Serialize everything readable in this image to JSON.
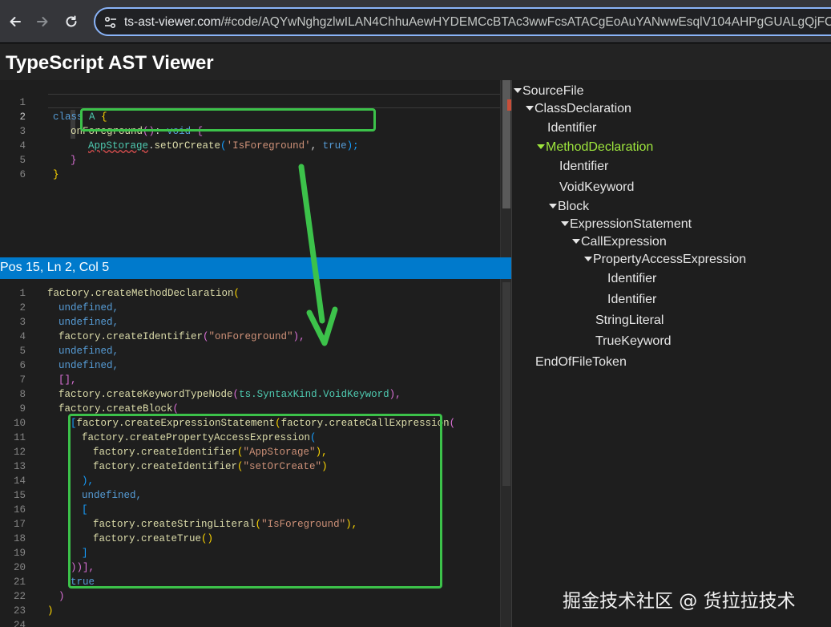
{
  "browser": {
    "url_host": "ts-ast-viewer.com",
    "url_rest": "/#code/AQYwNghgzlwILAN4ChhuAewHYDEMCcBTAc3wwFcsATACgEoAuYANwwEsqlV104AHPgGUALgQjFCAOiiFhAc"
  },
  "header": {
    "title": "TypeScript AST Viewer"
  },
  "status": {
    "text": "Pos 15, Ln 2, Col 5"
  },
  "source_code": {
    "line_numbers": [
      "1",
      "2",
      "3",
      "4",
      "5",
      "6"
    ],
    "l1": {
      "kw": "class",
      "name": "A",
      "brace": "{"
    },
    "l2": {
      "name": "onForeground",
      "paren": "()",
      "colon": ":",
      "type": "void",
      "brace": "{"
    },
    "l3": {
      "obj": "AppStorage",
      "dot": ".",
      "fn": "setOrCreate",
      "open": "(",
      "str": "'IsForeground'",
      "comma": ",",
      "val": "true",
      "close": ");"
    },
    "l4": {
      "brace": "}"
    },
    "l5": {
      "brace": "}"
    }
  },
  "factory_code": {
    "line_numbers": [
      "1",
      "2",
      "3",
      "4",
      "5",
      "6",
      "7",
      "8",
      "9",
      "10",
      "11",
      "12",
      "13",
      "14",
      "15",
      "16",
      "17",
      "18",
      "19",
      "20",
      "21",
      "22",
      "23",
      "24"
    ],
    "l1": {
      "fn": "factory.createMethodDeclaration",
      "open": "("
    },
    "l2": "undefined,",
    "l3": "undefined,",
    "l4": {
      "fn": "factory.createIdentifier",
      "open": "(",
      "str": "\"onForeground\"",
      "close": "),"
    },
    "l5": "undefined,",
    "l6": "undefined,",
    "l7": "[],",
    "l8": {
      "fn": "factory.createKeywordTypeNode",
      "open": "(",
      "arg": "ts.SyntaxKind.VoidKeyword",
      "close": "),"
    },
    "l9": {
      "fn": "factory.createBlock",
      "open": "("
    },
    "l10": {
      "open": "[",
      "fn": "factory.createExpressionStatement",
      "p": "(",
      "fn2": "factory.createCallExpression",
      "p2": "("
    },
    "l11": {
      "fn": "factory.createPropertyAccessExpression",
      "open": "("
    },
    "l12": {
      "fn": "factory.createIdentifier",
      "open": "(",
      "str": "\"AppStorage\"",
      "close": "),"
    },
    "l13": {
      "fn": "factory.createIdentifier",
      "open": "(",
      "str": "\"setOrCreate\"",
      "close": ")"
    },
    "l14": "),",
    "l15": "undefined,",
    "l16": "[",
    "l17": {
      "fn": "factory.createStringLiteral",
      "open": "(",
      "str": "\"IsForeground\"",
      "close": "),"
    },
    "l18": {
      "fn": "factory.createTrue",
      "open": "()"
    },
    "l19": "]",
    "l20": "))],",
    "l21": "true",
    "l22": ")",
    "l23": ")"
  },
  "tree": {
    "nodes": [
      {
        "label": "SourceFile",
        "expanded": true
      },
      {
        "label": "ClassDeclaration",
        "expanded": true
      },
      {
        "label": "Identifier"
      },
      {
        "label": "MethodDeclaration",
        "expanded": true,
        "selected": true
      },
      {
        "label": "Identifier"
      },
      {
        "label": "VoidKeyword"
      },
      {
        "label": "Block",
        "expanded": true
      },
      {
        "label": "ExpressionStatement",
        "expanded": true
      },
      {
        "label": "CallExpression",
        "expanded": true
      },
      {
        "label": "PropertyAccessExpression",
        "expanded": true
      },
      {
        "label": "Identifier"
      },
      {
        "label": "Identifier"
      },
      {
        "label": "StringLiteral"
      },
      {
        "label": "TrueKeyword"
      },
      {
        "label": "EndOfFileToken"
      }
    ]
  },
  "watermark": "掘金技术社区 @ 货拉拉技术",
  "colors": {
    "highlight": "#3cc24a",
    "status_bar": "#007acc",
    "selected_node": "#9ee63d"
  }
}
